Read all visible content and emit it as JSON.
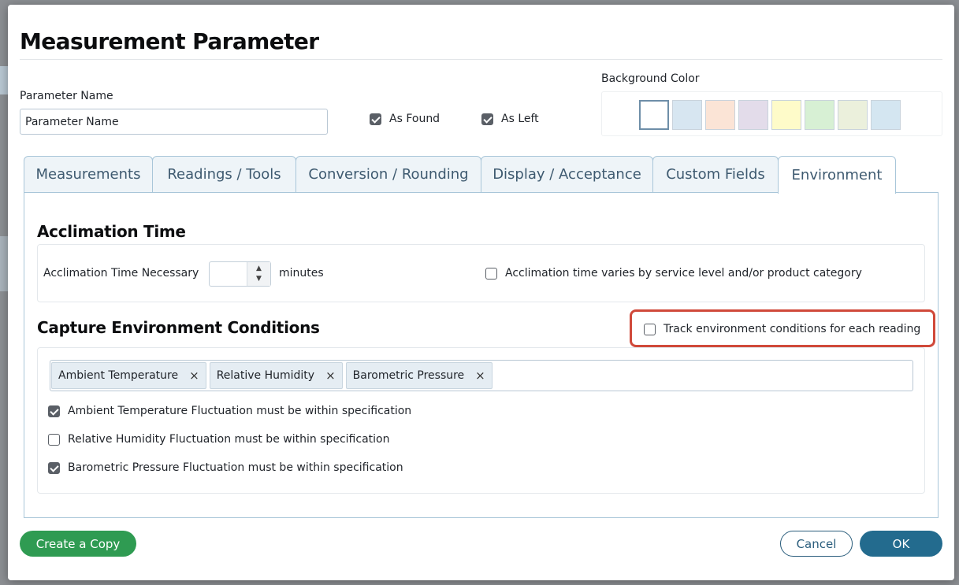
{
  "dialog": {
    "title": "Measurement Parameter"
  },
  "header": {
    "parameter_name_label": "Parameter Name",
    "parameter_name_value": "Parameter Name",
    "as_found": {
      "label": "As Found",
      "checked": true
    },
    "as_left": {
      "label": "As Left",
      "checked": true
    },
    "background_color_label": "Background Color",
    "swatches": [
      {
        "name": "white",
        "color": "#ffffff",
        "selected": true
      },
      {
        "name": "blue",
        "color": "#d7e6f1",
        "selected": false
      },
      {
        "name": "peach",
        "color": "#fbe4d6",
        "selected": false
      },
      {
        "name": "lavender",
        "color": "#e3dcea",
        "selected": false
      },
      {
        "name": "yellow",
        "color": "#fefbc9",
        "selected": false
      },
      {
        "name": "green",
        "color": "#d7f0d4",
        "selected": false
      },
      {
        "name": "sage",
        "color": "#ebf0dc",
        "selected": false
      },
      {
        "name": "light-blue",
        "color": "#d4e6f1",
        "selected": false
      }
    ]
  },
  "tabs": [
    {
      "label": "Measurements",
      "active": false
    },
    {
      "label": "Readings / Tools",
      "active": false
    },
    {
      "label": "Conversion / Rounding",
      "active": false
    },
    {
      "label": "Display / Acceptance",
      "active": false
    },
    {
      "label": "Custom Fields",
      "active": false
    },
    {
      "label": "Environment",
      "active": true
    }
  ],
  "acclimation": {
    "heading": "Acclimation Time",
    "necessary_label": "Acclimation Time Necessary",
    "value": "",
    "units": "minutes",
    "varies_label": "Acclimation time varies by service level and/or product category",
    "varies_checked": false
  },
  "environment": {
    "heading": "Capture Environment Conditions",
    "track_label": "Track environment conditions for each reading",
    "track_checked": false,
    "tags": [
      "Ambient Temperature",
      "Relative Humidity",
      "Barometric Pressure"
    ],
    "remove_glyph": "×",
    "fluctuations": [
      {
        "label": "Ambient Temperature Fluctuation must be within specification",
        "checked": true
      },
      {
        "label": "Relative Humidity Fluctuation must be within specification",
        "checked": false
      },
      {
        "label": "Barometric Pressure Fluctuation must be within specification",
        "checked": true
      }
    ]
  },
  "footer": {
    "copy_label": "Create a Copy",
    "cancel_label": "Cancel",
    "ok_label": "OK"
  },
  "spinner_glyphs": {
    "up": "▲",
    "down": "▼"
  },
  "colors": {
    "accent": "#236b8e",
    "create_copy": "#2f9b52",
    "highlight": "#d0493a",
    "tab_border": "#a9c6d9"
  }
}
